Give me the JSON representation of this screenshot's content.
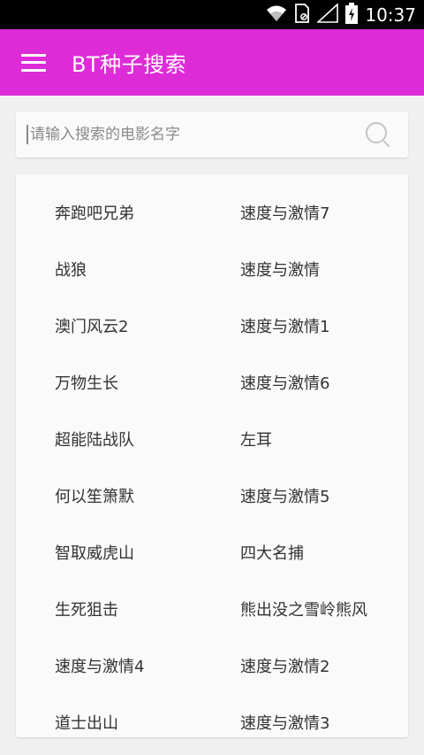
{
  "status_bar": {
    "time": "10:37",
    "icons": [
      "wifi-icon",
      "sim-icon",
      "signal-icon",
      "battery-icon"
    ]
  },
  "app_bar": {
    "title": "BT种子搜索",
    "menu_icon": "hamburger-menu-icon",
    "background_color": "#dd2bd8"
  },
  "search": {
    "placeholder": "请输入搜索的电影名字",
    "value": "",
    "icon": "search-icon"
  },
  "movies": [
    "奔跑吧兄弟",
    "速度与激情7",
    "战狼",
    "速度与激情",
    "澳门风云2",
    "速度与激情1",
    "万物生长",
    "速度与激情6",
    "超能陆战队",
    "左耳",
    "何以笙箫默",
    "速度与激情5",
    "智取威虎山",
    "四大名捕",
    "生死狙击",
    "熊出没之雪岭熊风",
    "速度与激情4",
    "速度与激情2",
    "道士出山",
    "速度与激情3"
  ]
}
